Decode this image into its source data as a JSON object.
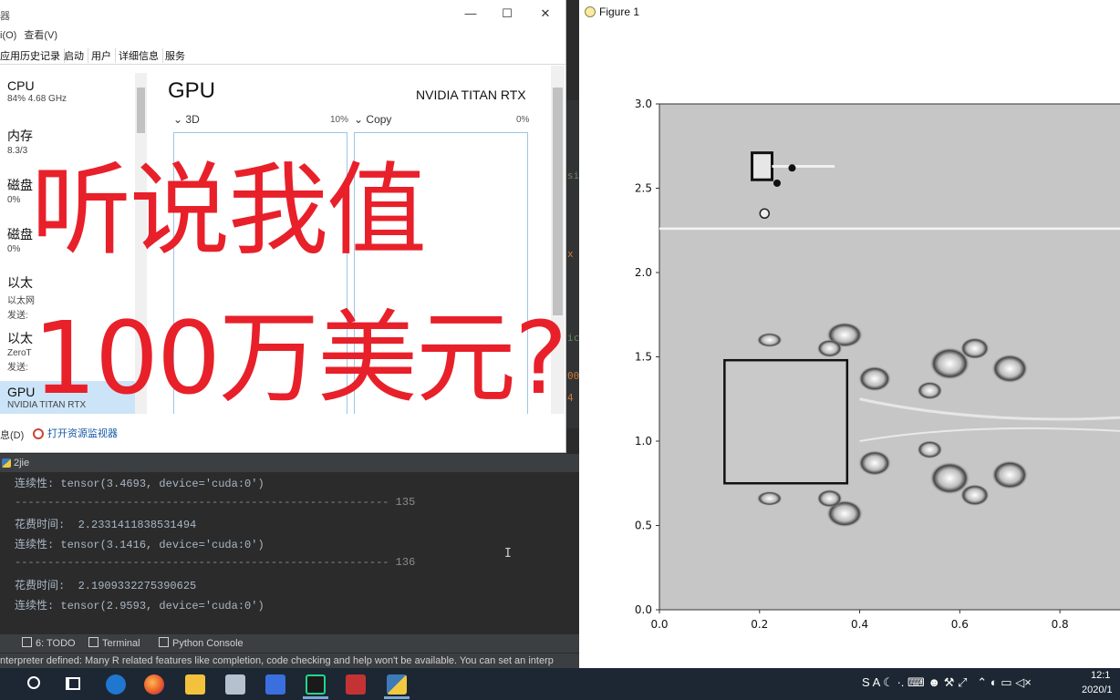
{
  "task_manager": {
    "title_fragment": "器",
    "menu": [
      "i(O)",
      "查看(V)"
    ],
    "tabs": [
      "应用历史记录",
      "启动",
      "用户",
      "详细信息",
      "服务"
    ],
    "resources": [
      {
        "name": "CPU",
        "sub": "84% 4.68 GHz"
      },
      {
        "name": "内存",
        "sub": "8.3/3"
      },
      {
        "name": "磁盘",
        "sub": "0%"
      },
      {
        "name": "磁盘",
        "sub": "0%"
      },
      {
        "name": "以太",
        "sub": "以太网",
        "sub2": "发送:"
      },
      {
        "name": "以太",
        "sub": "ZeroT",
        "sub2": "发送:"
      },
      {
        "name": "GPU",
        "sub": "NVIDIA TITAN RTX"
      }
    ],
    "gpu_heading": "GPU",
    "gpu_model": "NVIDIA TITAN RTX",
    "engines": [
      {
        "name": "3D",
        "pct": "10%"
      },
      {
        "name": "Copy",
        "pct": "0%"
      }
    ],
    "footer_left": "息(D)",
    "footer_link": "打开资源监视器"
  },
  "overlay": {
    "line1": "听说我值",
    "line2": "100万美元?"
  },
  "ide": {
    "fragments": [
      "si",
      "x",
      "ic",
      "00",
      "4"
    ],
    "run_tab": "2jie",
    "console_lines": [
      {
        "text": "连续性: tensor(3.4693, device='cuda:0')",
        "kind": "out"
      },
      {
        "text": "--------------------------------------------------------- 135",
        "kind": "sep"
      },
      {
        "text": "花费时间:  2.2331411838531494",
        "kind": "out"
      },
      {
        "text": "连续性: tensor(3.1416, device='cuda:0')",
        "kind": "out"
      },
      {
        "text": "--------------------------------------------------------- 136",
        "kind": "sep"
      },
      {
        "text": "花费时间:  2.1909332275390625",
        "kind": "out"
      },
      {
        "text": "连续性: tensor(2.9593, device='cuda:0')",
        "kind": "out"
      }
    ],
    "bottom_tabs": [
      "6: TODO",
      "Terminal",
      "Python Console"
    ],
    "status_text": "nterpreter defined: Many R related features like completion, code checking and help won't be available. You can set an interp"
  },
  "figure": {
    "title": "Figure 1",
    "chart_data": {
      "type": "heatmap",
      "title": "",
      "xlabel": "",
      "ylabel": "",
      "x_ticks": [
        "0.0",
        "0.2",
        "0.4",
        "0.6",
        "0.8"
      ],
      "y_ticks": [
        "0.0",
        "0.5",
        "1.0",
        "1.5",
        "2.0",
        "2.5",
        "3.0"
      ],
      "xlim": [
        0.0,
        0.92
      ],
      "ylim": [
        0.0,
        3.0
      ],
      "obstacles": [
        {
          "label": "square",
          "x0": 0.13,
          "x1": 0.375,
          "y0": 0.75,
          "y1": 1.48
        }
      ],
      "interface_line_y": 2.26,
      "colormap": "grayscale"
    }
  },
  "taskbar": {
    "time": "12:1",
    "date": "2020/1"
  }
}
